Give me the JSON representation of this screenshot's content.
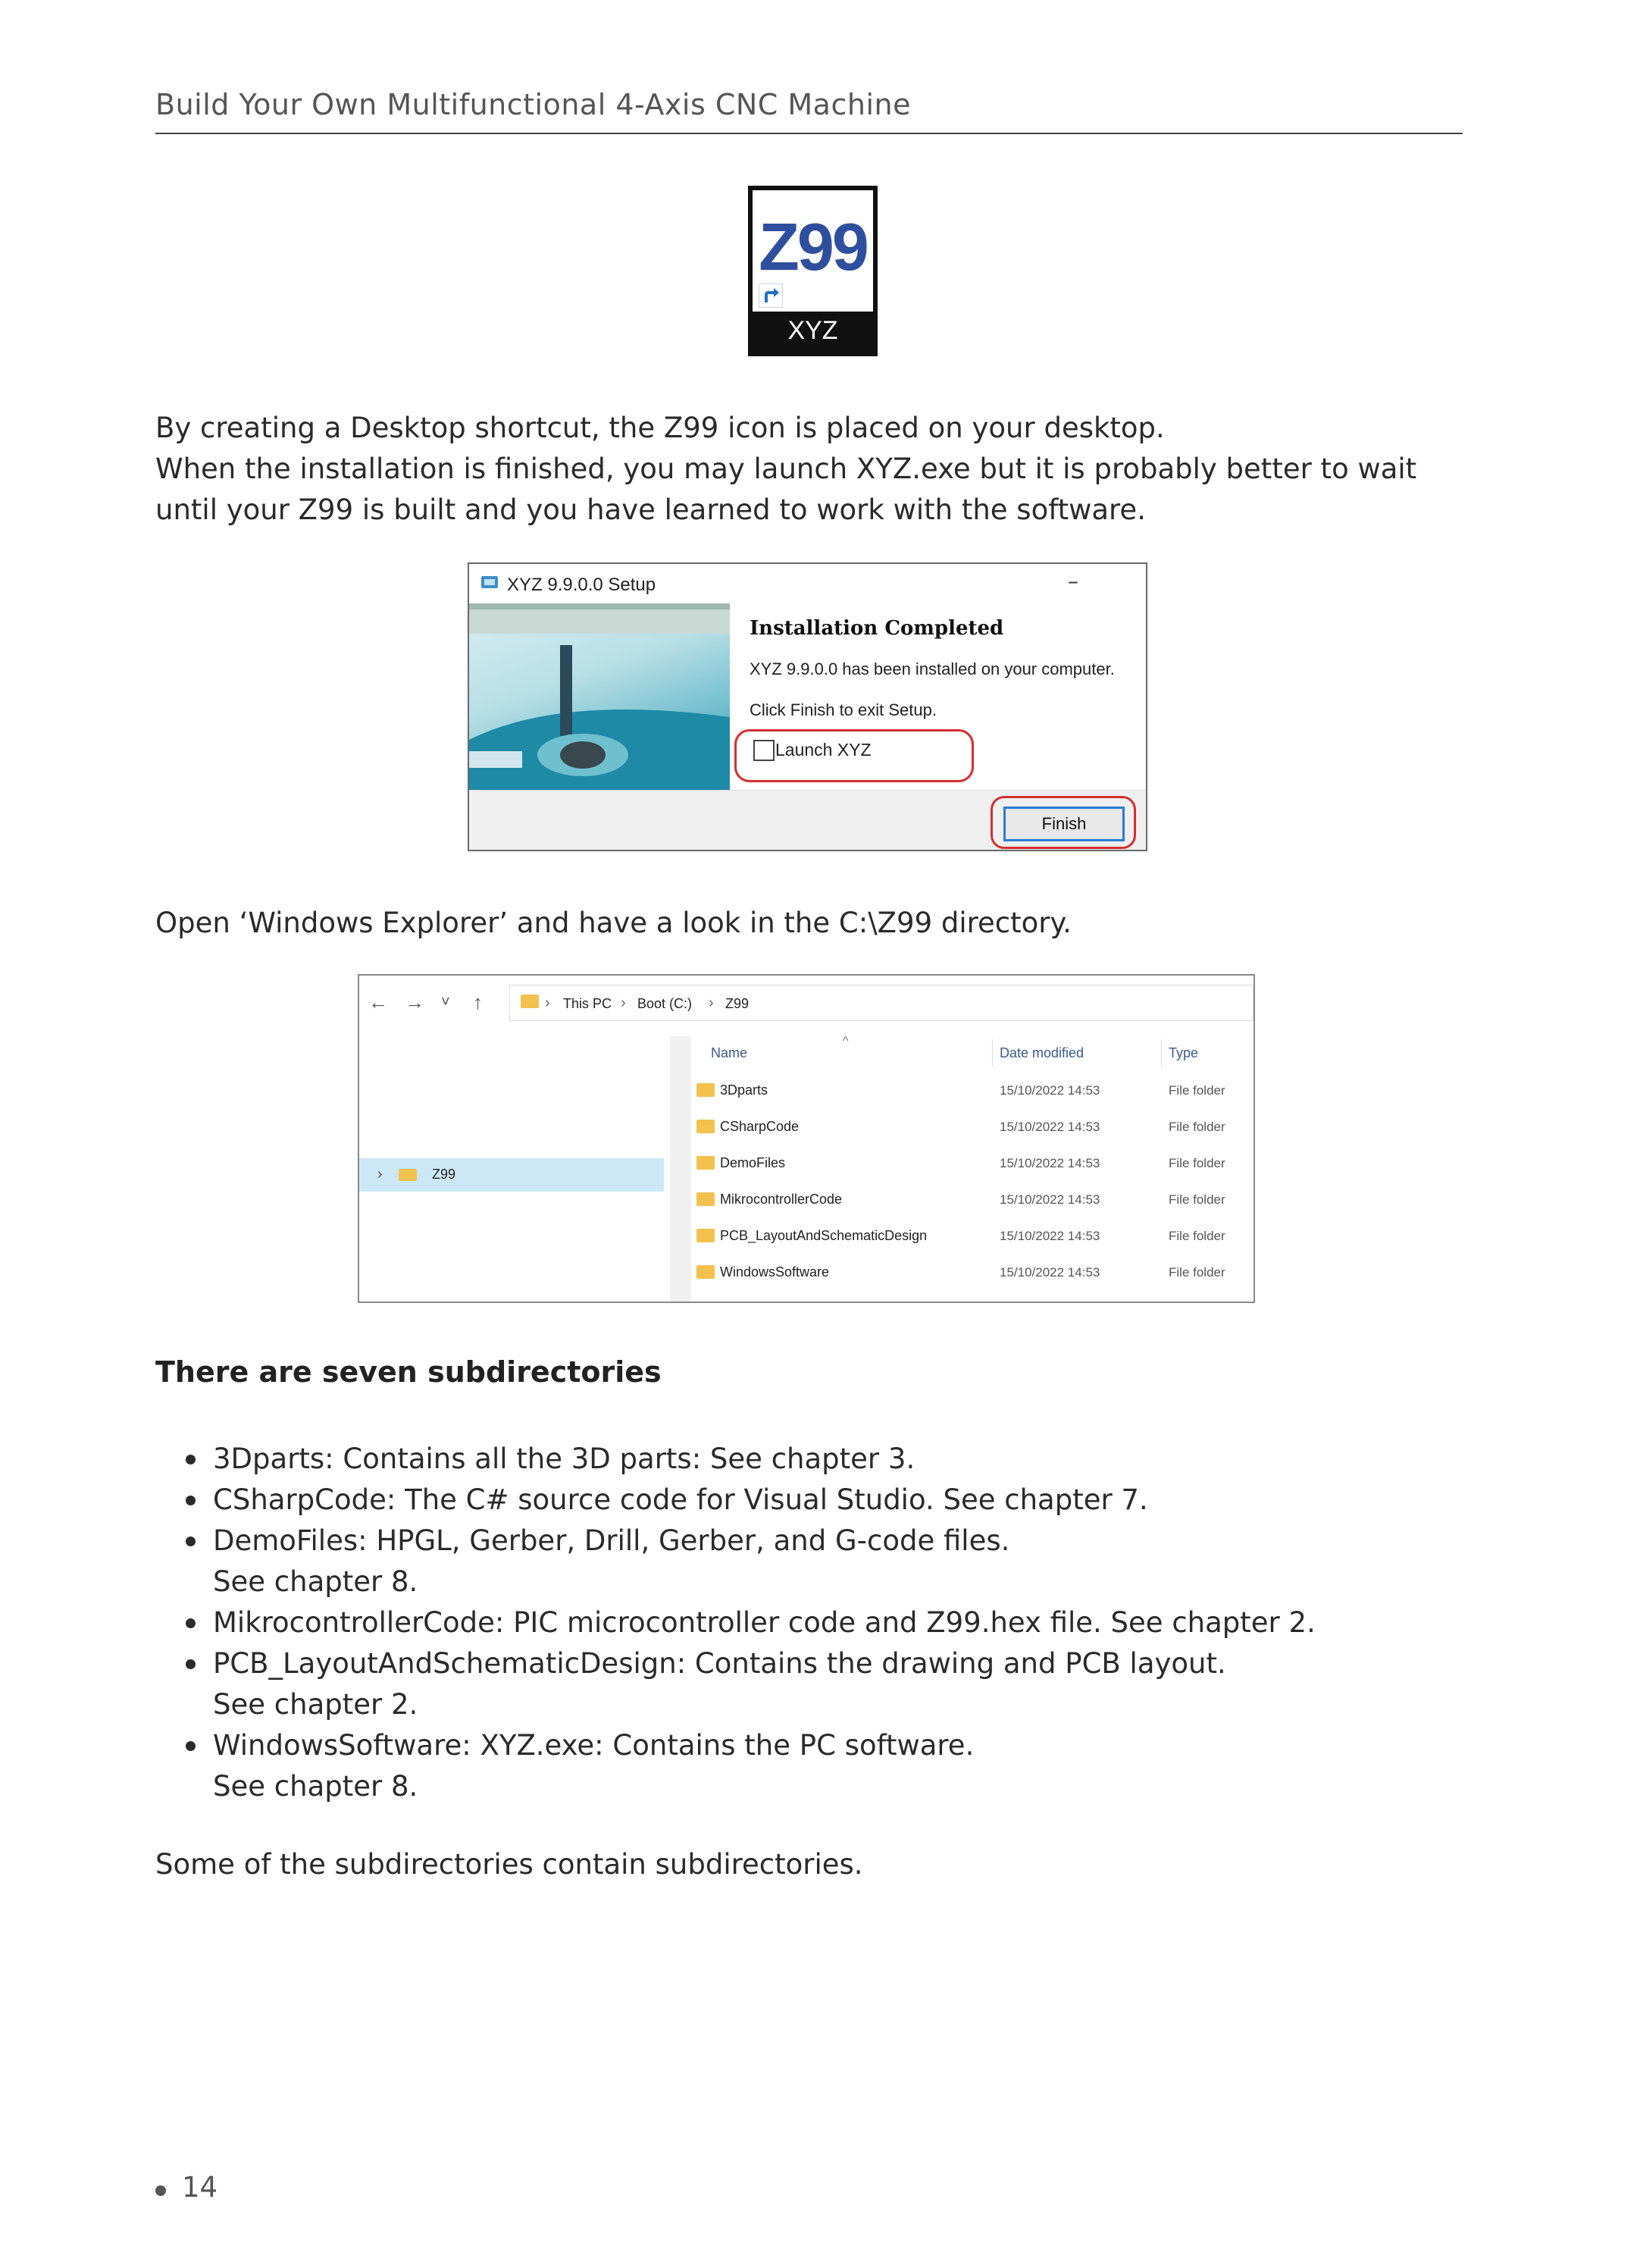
{
  "header": {
    "title": "Build Your Own Multifunctional 4-Axis CNC Machine"
  },
  "desktop_icon": {
    "title": "Z99",
    "label": "XYZ"
  },
  "intro": {
    "line1": "By creating a Desktop shortcut, the Z99 icon is placed on your desktop.",
    "line2": "When the installation is finished, you may launch XYZ.exe but it is probably better to wait",
    "line3": "until your Z99 is built and you have learned to work with the software."
  },
  "setup_dialog": {
    "title": "XYZ 9.9.0.0 Setup",
    "minimize": "–",
    "heading": "Installation Completed",
    "message": "XYZ 9.9.0.0 has been installed on your computer.",
    "instruction": "Click Finish to exit Setup.",
    "launch_label": "Launch XYZ",
    "launch_checked": false,
    "finish_label": "Finish"
  },
  "explorer_intro": "Open ‘Windows Explorer’ and have a look in the C:\\Z99 directory.",
  "explorer": {
    "nav": {
      "back": "←",
      "forward": "→",
      "recent": "˅",
      "up": "↑"
    },
    "breadcrumb": [
      "This PC",
      "Boot (C:)",
      "Z99"
    ],
    "tree_item": "Z99",
    "columns": {
      "name": "Name",
      "date": "Date modified",
      "type": "Type"
    },
    "rows": [
      {
        "name": "3Dparts",
        "date": "15/10/2022 14:53",
        "type": "File folder"
      },
      {
        "name": "CSharpCode",
        "date": "15/10/2022 14:53",
        "type": "File folder"
      },
      {
        "name": "DemoFiles",
        "date": "15/10/2022 14:53",
        "type": "File folder"
      },
      {
        "name": "MikrocontrollerCode",
        "date": "15/10/2022 14:53",
        "type": "File folder"
      },
      {
        "name": "PCB_LayoutAndSchematicDesign",
        "date": "15/10/2022 14:53",
        "type": "File folder"
      },
      {
        "name": "WindowsSoftware",
        "date": "15/10/2022 14:53",
        "type": "File folder"
      }
    ]
  },
  "subdirs_heading": "There are seven subdirectories",
  "bullets": [
    {
      "line1": "3Dparts: Contains all the 3D parts: See chapter 3.",
      "line2": ""
    },
    {
      "line1": "CSharpCode: The C# source code for Visual Studio. See chapter 7.",
      "line2": ""
    },
    {
      "line1": "DemoFiles: HPGL, Gerber, Drill, Gerber, and G-code files.",
      "line2": "See chapter 8."
    },
    {
      "line1": "MikrocontrollerCode: PIC microcontroller code and Z99.hex file. See chapter 2.",
      "line2": ""
    },
    {
      "line1": "PCB_LayoutAndSchematicDesign: Contains the drawing and PCB layout.",
      "line2": "See chapter 2."
    },
    {
      "line1": "WindowsSoftware: XYZ.exe: Contains the PC software.",
      "line2": "See chapter 8."
    }
  ],
  "closing": "Some of the subdirectories contain subdirectories.",
  "page_number": "14"
}
